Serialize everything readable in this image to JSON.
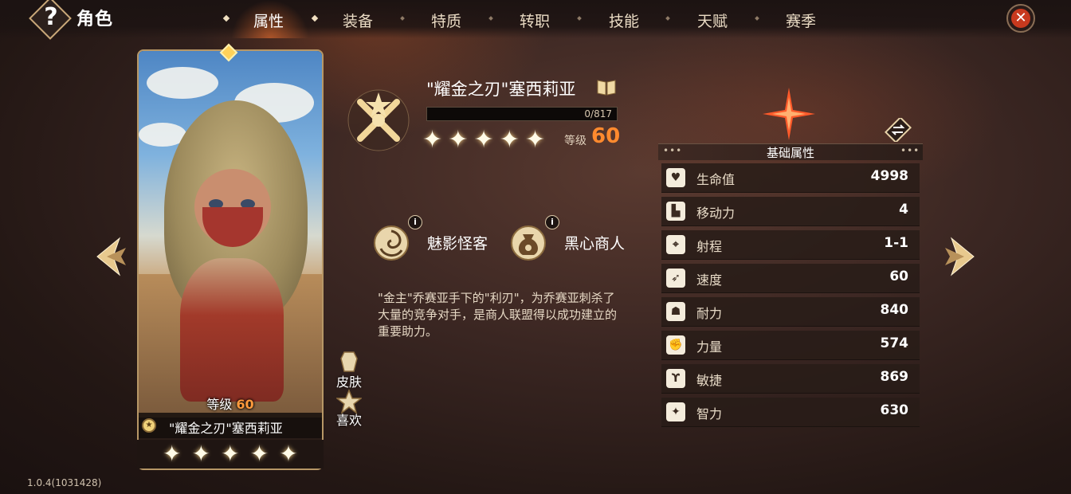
{
  "header": {
    "help_icon_glyph": "?",
    "title": "角色",
    "tabs": [
      {
        "label": "属性",
        "active": true
      },
      {
        "label": "装备",
        "active": false
      },
      {
        "label": "特质",
        "active": false
      },
      {
        "label": "转职",
        "active": false
      },
      {
        "label": "技能",
        "active": false
      },
      {
        "label": "天赋",
        "active": false
      },
      {
        "label": "赛季",
        "active": false
      }
    ],
    "close_glyph": "✕"
  },
  "card": {
    "level_label": "等级",
    "level_value": "60",
    "name": "\"耀金之刃\"塞西莉亚",
    "star_count": 5,
    "star_glyph": "✦"
  },
  "side_buttons": {
    "skin_label": "皮肤",
    "like_label": "喜欢"
  },
  "hero": {
    "title": "\"耀金之刃\"塞西莉亚",
    "exp_text": "0/817",
    "exp_progress": 0,
    "level_label": "等级",
    "level_value": "60",
    "star_glyph": "✦"
  },
  "traits": [
    {
      "name": "魅影怪客",
      "icon": "swirl-trait-icon",
      "info": "i"
    },
    {
      "name": "黑心商人",
      "icon": "money-bag-trait-icon",
      "info": "i"
    }
  ],
  "description": "\"金主\"乔赛亚手下的\"利刃\"，为乔赛亚刺杀了大量的竞争对手，是商人联盟得以成功建立的重要助力。",
  "stats": {
    "header": "基础属性",
    "dots": "•••",
    "rows": [
      {
        "icon": "heart-icon",
        "glyph": "♥",
        "name": "生命值",
        "value": "4998"
      },
      {
        "icon": "boot-icon",
        "glyph": "▙",
        "name": "移动力",
        "value": "4"
      },
      {
        "icon": "crosshair-icon",
        "glyph": "⌖",
        "name": "射程",
        "value": "1-1"
      },
      {
        "icon": "feather-icon",
        "glyph": "➶",
        "name": "速度",
        "value": "60"
      },
      {
        "icon": "person-icon",
        "glyph": "☗",
        "name": "耐力",
        "value": "840"
      },
      {
        "icon": "arm-icon",
        "glyph": "✊",
        "name": "力量",
        "value": "574"
      },
      {
        "icon": "agility-icon",
        "glyph": "ϒ",
        "name": "敏捷",
        "value": "869"
      },
      {
        "icon": "spark-icon",
        "glyph": "✦",
        "name": "智力",
        "value": "630"
      }
    ]
  },
  "version": "1.0.4(1031428)",
  "colors": {
    "accent_orange": "#ff8a2e",
    "close_red": "#c8391e",
    "frame_gold": "#b79766"
  }
}
